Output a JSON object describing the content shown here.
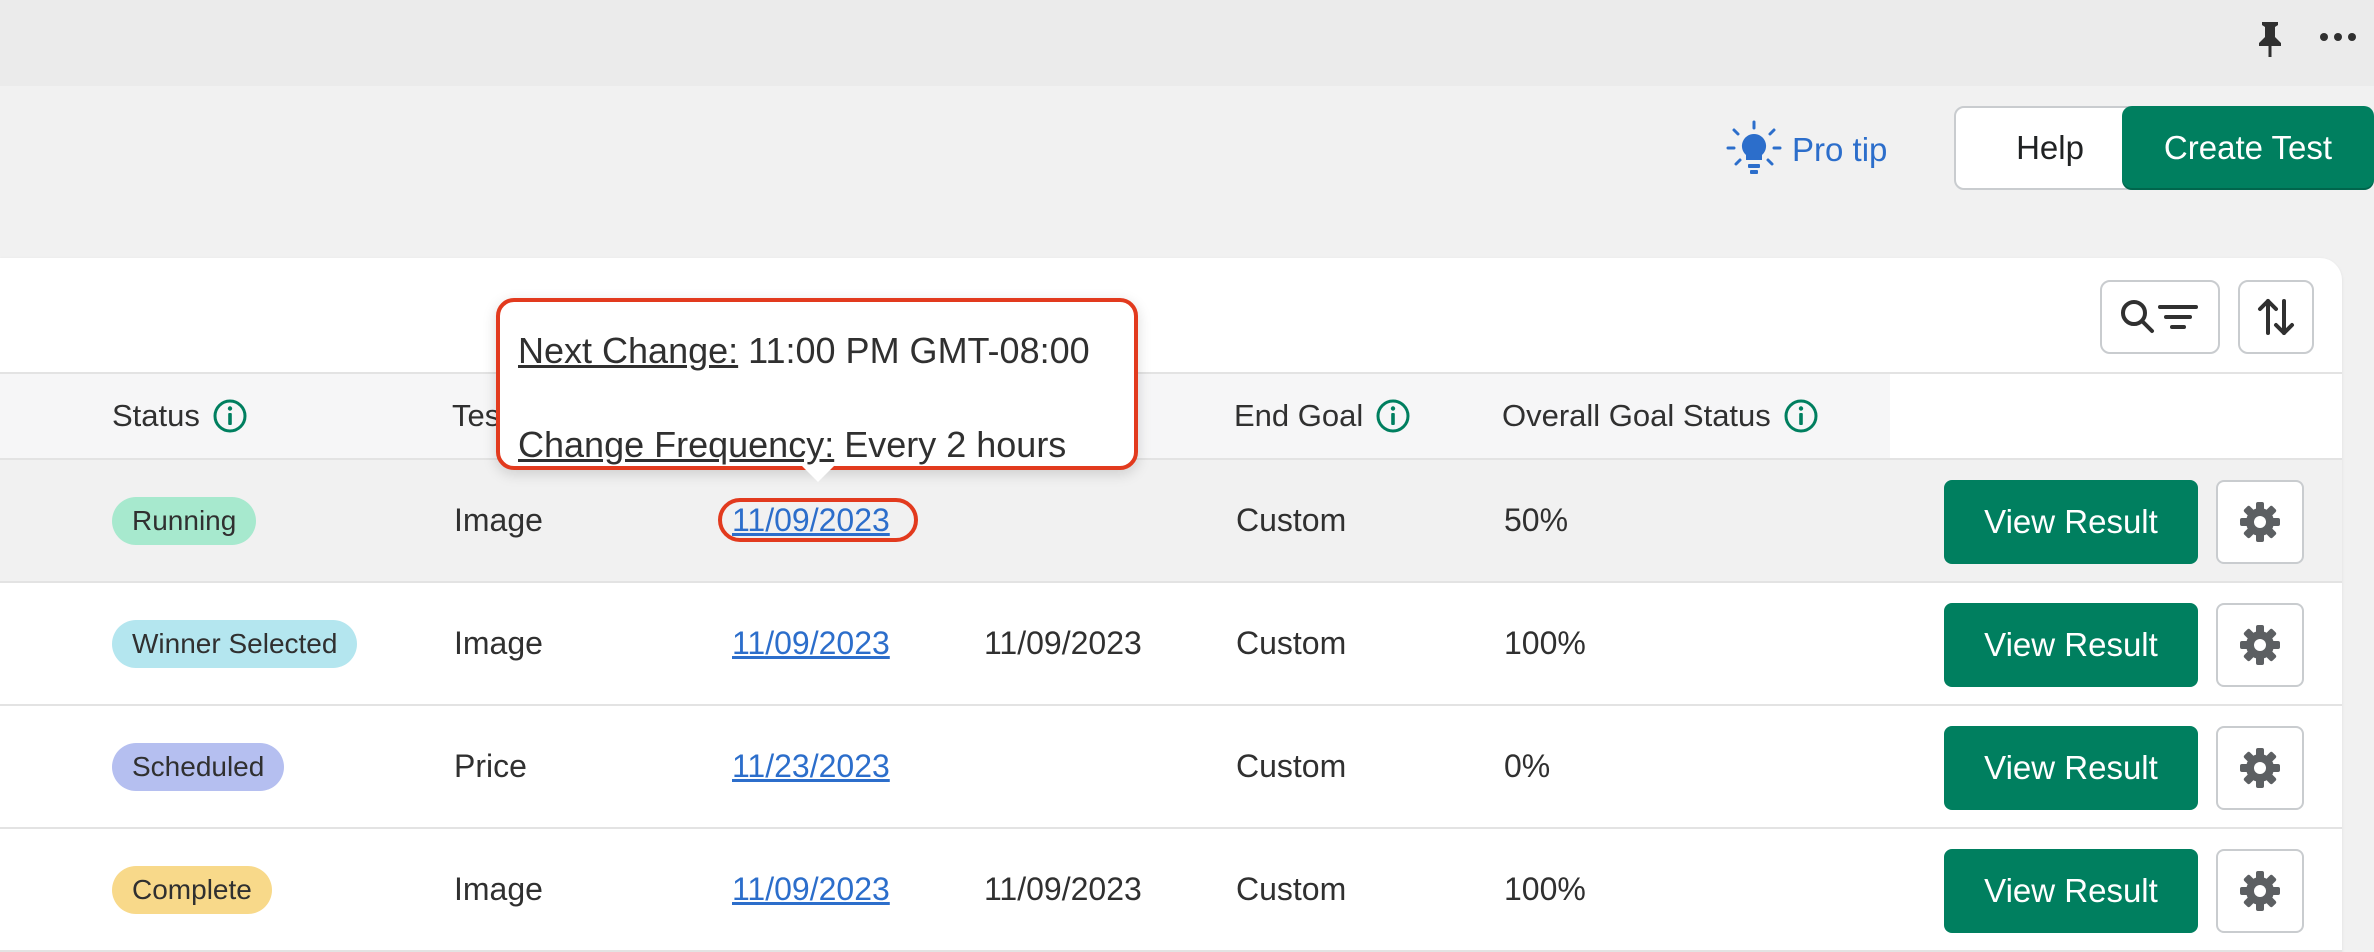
{
  "colors": {
    "primary": "#007f5f",
    "link": "#2c6ecb",
    "highlight_outline": "#e23a1e",
    "badge_running": "#a7e9ce",
    "badge_winner": "#b4e6ef",
    "badge_scheduled": "#b5bff0",
    "badge_complete": "#f8d98a"
  },
  "header": {
    "pro_tip_label": "Pro tip",
    "help_label": "Help",
    "create_label": "Create Test"
  },
  "table": {
    "columns": {
      "status": "Status",
      "test_type": "Tes",
      "end_goal": "End Goal",
      "overall": "Overall Goal Status"
    },
    "rows": [
      {
        "status": "Running",
        "type": "Image",
        "start": "11/09/2023",
        "end": "",
        "goal": "Custom",
        "overall": "50%",
        "action": "View Result"
      },
      {
        "status": "Winner Selected",
        "type": "Image",
        "start": "11/09/2023",
        "end": "11/09/2023",
        "goal": "Custom",
        "overall": "100%",
        "action": "View Result"
      },
      {
        "status": "Scheduled",
        "type": "Price",
        "start": "11/23/2023",
        "end": "",
        "goal": "Custom",
        "overall": "0%",
        "action": "View Result"
      },
      {
        "status": "Complete",
        "type": "Image",
        "start": "11/09/2023",
        "end": "11/09/2023",
        "goal": "Custom",
        "overall": "100%",
        "action": "View Result"
      }
    ]
  },
  "tooltip": {
    "next_change_label": "Next Change:",
    "next_change_value": "11:00 PM GMT-08:00",
    "frequency_label": "Change Frequency:",
    "frequency_value": "Every 2 hours"
  }
}
